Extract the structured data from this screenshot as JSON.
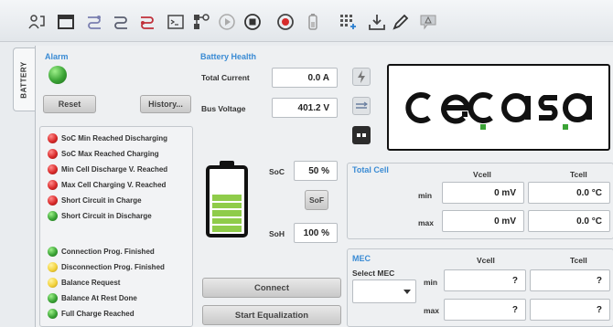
{
  "side_tab": {
    "label": "BATTERY"
  },
  "alarm": {
    "title": "Alarm",
    "reset_label": "Reset",
    "history_label": "History...",
    "items": [
      {
        "label": "SoC Min Reached Discharging",
        "status": "red"
      },
      {
        "label": "SoC Max Reached Charging",
        "status": "red"
      },
      {
        "label": "Min Cell Discharge V. Reached",
        "status": "red"
      },
      {
        "label": "Max Cell Charging V. Reached",
        "status": "red"
      },
      {
        "label": "Short Circuit in Charge",
        "status": "red"
      },
      {
        "label": "Short Circuit in Discharge",
        "status": "green"
      },
      {
        "label": "Connection Prog. Finished",
        "status": "green"
      },
      {
        "label": "Disconnection Prog. Finished",
        "status": "yellow"
      },
      {
        "label": "Balance Request",
        "status": "yellow"
      },
      {
        "label": "Balance At Rest Done",
        "status": "green"
      },
      {
        "label": "Full Charge Reached",
        "status": "green"
      }
    ]
  },
  "battery_health": {
    "title": "Battery Health",
    "total_current_label": "Total Current",
    "total_current_value": "0.0 A",
    "bus_voltage_label": "Bus Voltage",
    "bus_voltage_value": "401.2 V",
    "soc_label": "SoC",
    "soc_value": "50 %",
    "sof_label": "SoF",
    "soh_label": "SoH",
    "soh_value": "100 %",
    "battery_level_bars": 5,
    "battery_total_bars": 8,
    "connect_label": "Connect",
    "equalization_label": "Start Equalization"
  },
  "logo": {
    "text": "cecasa"
  },
  "total_cell": {
    "title": "Total Cell",
    "col_vcell": "Vcell",
    "col_tcell": "Tcell",
    "min_label": "min",
    "max_label": "max",
    "min_vcell": "0 mV",
    "min_tcell": "0.0 °C",
    "max_vcell": "0 mV",
    "max_tcell": "0.0 °C"
  },
  "mec": {
    "title": "MEC",
    "select_label": "Select MEC",
    "col_vcell": "Vcell",
    "col_tcell": "Tcell",
    "min_label": "min",
    "max_label": "max",
    "min_vcell": "?",
    "min_tcell": "?",
    "max_vcell": "?",
    "max_tcell": "?"
  },
  "colors": {
    "accent": "#3a8bd4",
    "red": "#d92a2a",
    "green": "#3aa335",
    "yellow": "#f2d23c",
    "battery_green": "#8fcc4a"
  },
  "toolbar_icons": [
    "user-login-icon",
    "folder-icon",
    "connect-icon",
    "disconnect-icon",
    "link-icon",
    "terminal-icon",
    "network-icon",
    "play-icon",
    "stop-icon",
    "record-icon",
    "battery-device-icon",
    "grid-add-icon",
    "download-icon",
    "edit-icon",
    "warning-flag-icon"
  ]
}
